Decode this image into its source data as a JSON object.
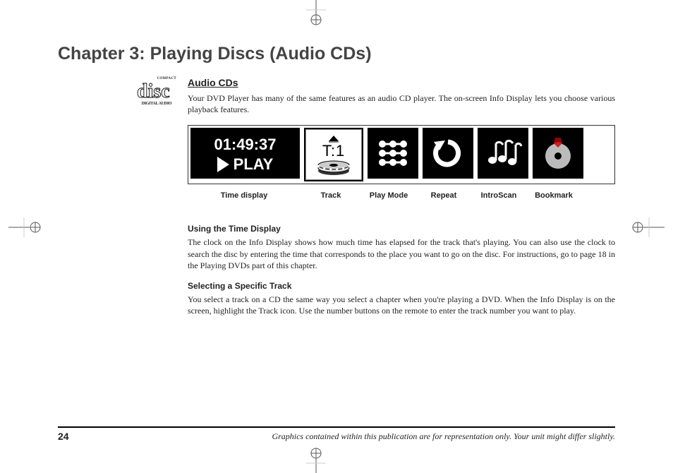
{
  "chapterTitle": "Chapter 3: Playing Discs (Audio CDs)",
  "logo": {
    "compact": "COMPACT",
    "disc": "disc",
    "digAudio": "DIGITAL AUDIO"
  },
  "section": {
    "title": "Audio CDs",
    "intro": "Your DVD Player has many of the same features as an audio CD player. The on-screen Info Display lets you choose various playback features."
  },
  "infoStrip": {
    "time": "01:49:37",
    "playLabel": "PLAY",
    "track": "T:1"
  },
  "labels": {
    "time": "Time display",
    "track": "Track",
    "playmode": "Play Mode",
    "repeat": "Repeat",
    "introscan": "IntroScan",
    "bookmark": "Bookmark"
  },
  "sub1": {
    "heading": "Using the Time Display",
    "body": "The clock on the Info Display shows how much time has elapsed for the track that's playing. You can also use the clock to search the disc by entering the time that corresponds to the place you want to go on the disc. For instructions, go to page 18 in the Playing DVDs part of this chapter."
  },
  "sub2": {
    "heading": "Selecting a Specific Track",
    "body": "You select a track on a CD the same way you select a chapter when you're playing a DVD. When the Info Display is on the screen, highlight the Track icon. Use the number buttons on the remote to enter the track number you want to play."
  },
  "pageNumber": "24",
  "footerNote": "Graphics contained within this publication are for representation only. Your unit might differ slightly."
}
